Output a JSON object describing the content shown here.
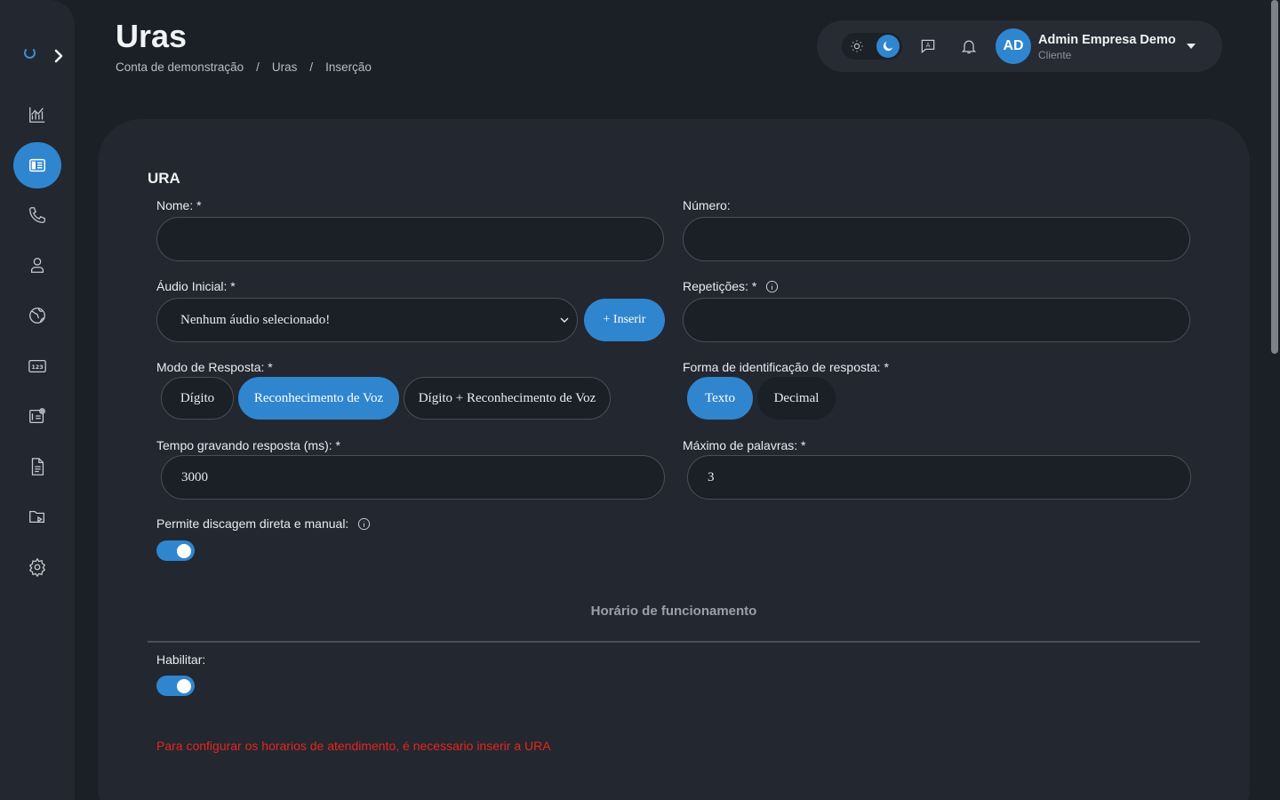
{
  "header": {
    "title": "Uras",
    "breadcrumb": [
      "Conta de demonstração",
      "Uras",
      "Inserção"
    ],
    "breadcrumb_sep": "/",
    "user": {
      "initials": "AD",
      "name": "Admin Empresa Demo",
      "role": "Cliente"
    },
    "theme": "dark"
  },
  "sidebar": {
    "items": [
      {
        "icon": "chart-icon",
        "active": false
      },
      {
        "icon": "ura-icon",
        "active": true
      },
      {
        "icon": "phone-icon",
        "active": false
      },
      {
        "icon": "user-icon",
        "active": false
      },
      {
        "icon": "globe-icon",
        "active": false
      },
      {
        "icon": "numbers-icon",
        "active": false
      },
      {
        "icon": "contact-card-icon",
        "active": false
      },
      {
        "icon": "document-icon",
        "active": false
      },
      {
        "icon": "media-folder-icon",
        "active": false
      },
      {
        "icon": "settings-icon",
        "active": false
      }
    ]
  },
  "form": {
    "section_title": "URA",
    "nome": {
      "label": "Nome: *",
      "value": ""
    },
    "numero": {
      "label": "Número:",
      "value": ""
    },
    "audio_inicial": {
      "label": "Áudio Inicial: *",
      "selected": "Nenhum áudio selecionado!",
      "insert_label": "+ Inserir"
    },
    "repeticoes": {
      "label": "Repetições: *",
      "value": ""
    },
    "modo_resposta": {
      "label": "Modo de Resposta: *",
      "options": [
        "Dígito",
        "Reconhecimento de Voz",
        "Dígito + Reconhecimento de Voz"
      ],
      "selected": "Reconhecimento de Voz"
    },
    "forma_identificacao": {
      "label": "Forma de identificação de resposta: *",
      "options": [
        "Texto",
        "Decimal"
      ],
      "selected": "Texto"
    },
    "tempo_gravando": {
      "label": "Tempo gravando resposta (ms): *",
      "value": "3000"
    },
    "maximo_palavras": {
      "label": "Máximo de palavras: *",
      "value": "3"
    },
    "discagem_direta": {
      "label": "Permite discagem direta e manual:",
      "enabled": true
    }
  },
  "horario": {
    "title": "Horário de funcionamento",
    "habilitar_label": "Habilitar:",
    "habilitar_enabled": true,
    "warning": "Para configurar os horarios de atendimento, é necessario inserir a URA"
  },
  "colors": {
    "accent": "#2f86cf",
    "background": "#1b1f26",
    "card": "#222730",
    "error": "#e5271d"
  }
}
